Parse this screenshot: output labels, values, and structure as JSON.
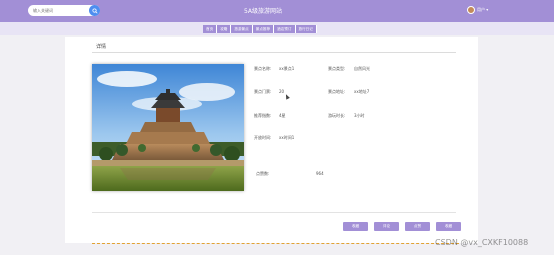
{
  "header": {
    "search_placeholder": "输入关键词",
    "site_title": "5A级旅游网站",
    "user_name": "用户 ▾"
  },
  "nav": {
    "items": [
      "首页",
      "攻略",
      "旅游景点",
      "景点推荐",
      "酒店预订",
      "旅行日记"
    ]
  },
  "detail": {
    "title": "详情",
    "fields": {
      "name_label": "景点名称:",
      "name_value": "xx景点1",
      "type_label": "景点类型:",
      "type_value": "自然风光",
      "ticket_label": "景点门票:",
      "ticket_value": "20",
      "address_label": "景点地址:",
      "address_value": "xx地址7",
      "rating_label": "推荐指数:",
      "rating_value": "4星",
      "duration_label": "游玩时长:",
      "duration_value": "3小时",
      "open_label": "开放时间:",
      "open_value": "xx时间1",
      "views_label": "点赞数:",
      "views_value": "964"
    }
  },
  "buttons": [
    "收藏",
    "评论",
    "点赞",
    "收藏"
  ],
  "watermark": "CSDN @vx_CXKF10088",
  "colors": {
    "accent": "#a28fd6",
    "header_bg": "#a28fd6",
    "nav_band": "#e8e4f5",
    "search_button": "#4e8ef0",
    "dashed_line": "#e2a233"
  },
  "icons": {
    "search": "search-icon",
    "avatar": "user-avatar"
  }
}
